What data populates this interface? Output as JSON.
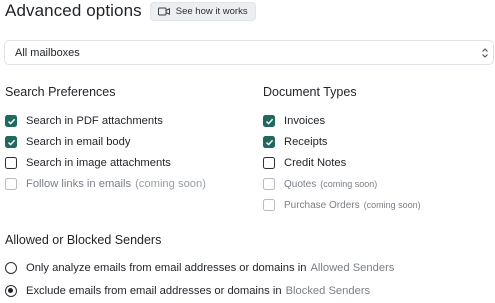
{
  "header": {
    "title": "Advanced options",
    "how_label": "See how it works"
  },
  "mailbox_select": {
    "value": "All mailboxes"
  },
  "search_preferences": {
    "title": "Search Preferences",
    "items": [
      {
        "label": "Search in PDF attachments",
        "checked": true
      },
      {
        "label": "Search in email body",
        "checked": true
      },
      {
        "label": "Search in image attachments",
        "checked": false
      },
      {
        "label": "Follow links in emails",
        "soon": "(coming soon)",
        "checked": false,
        "disabled": true
      }
    ]
  },
  "document_types": {
    "title": "Document Types",
    "items": [
      {
        "label": "Invoices",
        "checked": true
      },
      {
        "label": "Receipts",
        "checked": true
      },
      {
        "label": "Credit Notes",
        "checked": false
      },
      {
        "label": "Quotes",
        "soon": "(coming soon)",
        "checked": false,
        "disabled": true
      },
      {
        "label": "Purchase Orders",
        "soon": "(coming soon)",
        "checked": false,
        "disabled": true
      }
    ]
  },
  "senders": {
    "title": "Allowed or Blocked Senders",
    "options": [
      {
        "label": "Only analyze emails from email addresses or domains in",
        "suffix": "Allowed Senders",
        "checked": false
      },
      {
        "label": "Exclude emails from email addresses or domains in",
        "suffix": "Blocked Senders",
        "checked": true
      }
    ]
  },
  "colors": {
    "accent": "#20695e"
  }
}
